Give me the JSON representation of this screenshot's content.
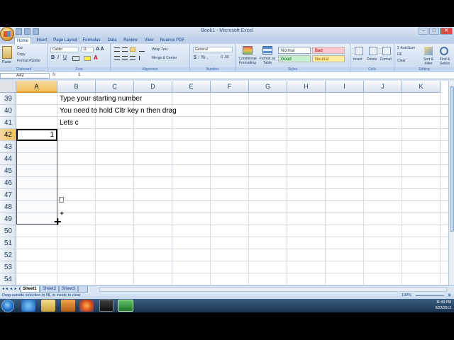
{
  "window": {
    "title": "Book1 - Microsoft Excel"
  },
  "ribbon_tabs": [
    "Home",
    "Insert",
    "Page Layout",
    "Formulas",
    "Data",
    "Review",
    "View",
    "Nuance PDF"
  ],
  "clipboard": {
    "paste": "Paste",
    "cut": "Cut",
    "copy": "Copy",
    "format_painter": "Format Painter",
    "label": "Clipboard"
  },
  "font": {
    "name": "Calibri",
    "size": "11",
    "label": "Font"
  },
  "alignment": {
    "wrap": "Wrap Text",
    "merge": "Merge & Center",
    "label": "Alignment"
  },
  "number": {
    "format": "General",
    "label": "Number"
  },
  "styles": {
    "conditional": "Conditional Formatting",
    "format_table": "Format as Table",
    "normal": "Normal",
    "bad": "Bad",
    "good": "Good",
    "neutral": "Neutral",
    "label": "Styles"
  },
  "cells_group": {
    "insert": "Insert",
    "delete": "Delete",
    "format": "Format",
    "label": "Cells"
  },
  "editing": {
    "autosum": "AutoSum",
    "fill": "Fill",
    "clear": "Clear",
    "sort": "Sort & Filter",
    "find": "Find & Select",
    "label": "Editing"
  },
  "formula_bar": {
    "name_box": "A42",
    "fx": "fx",
    "formula": "1"
  },
  "columns": [
    "A",
    "B",
    "C",
    "D",
    "E",
    "F",
    "G",
    "H",
    "I",
    "J",
    "K"
  ],
  "selected_column": "A",
  "rows": [
    "39",
    "40",
    "41",
    "42",
    "43",
    "44",
    "45",
    "46",
    "47",
    "48",
    "49",
    "50",
    "51",
    "52",
    "53",
    "54"
  ],
  "selected_row": "42",
  "cells": {
    "b39": "Type your starting number",
    "b40": "You need to hold Cltr key n then drag",
    "b41": "Lets c",
    "a42": "1"
  },
  "sheets": [
    "Sheet1",
    "Sheet2",
    "Sheet3"
  ],
  "active_sheet": "Sheet1",
  "status": {
    "message": "Drag outside selection to fill, or inside to clear",
    "zoom": "190%"
  },
  "taskbar": {
    "time": "11:49 PM",
    "date": "8/23/2013"
  }
}
